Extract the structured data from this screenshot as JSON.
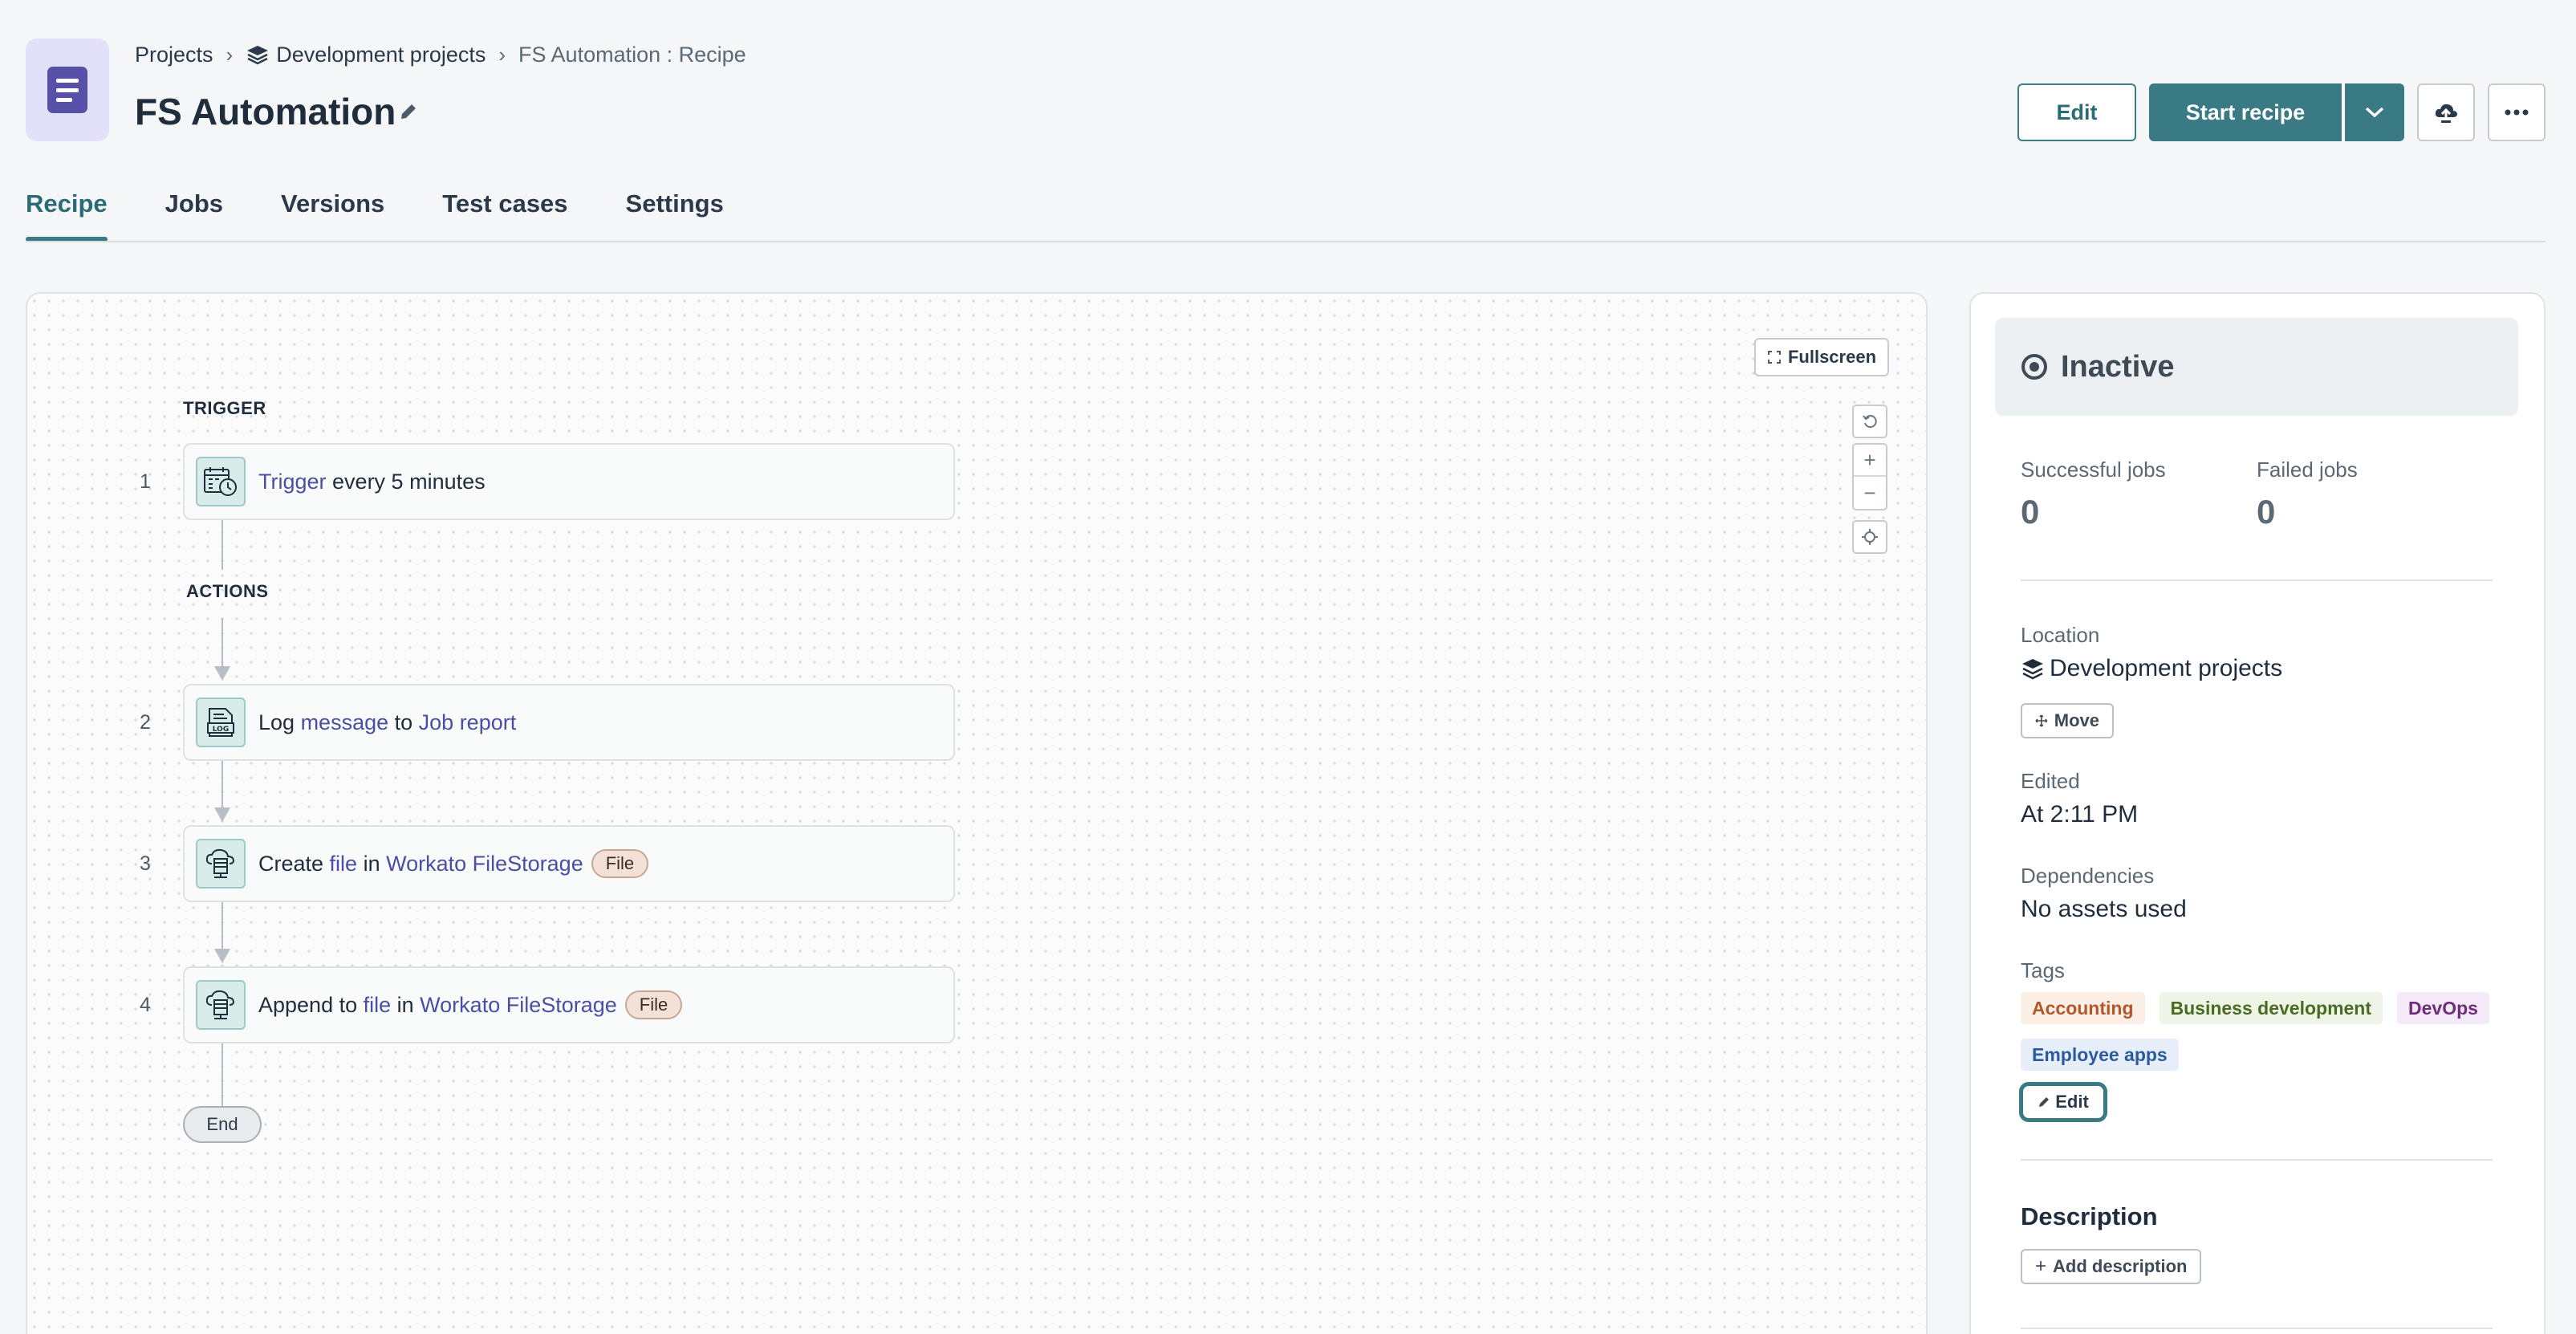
{
  "breadcrumb": {
    "projects": "Projects",
    "folder": "Development projects",
    "current": "FS Automation : Recipe"
  },
  "header": {
    "title": "FS Automation",
    "edit_label": "Edit",
    "start_label": "Start recipe"
  },
  "tabs": [
    {
      "label": "Recipe",
      "active": true
    },
    {
      "label": "Jobs"
    },
    {
      "label": "Versions"
    },
    {
      "label": "Test cases"
    },
    {
      "label": "Settings"
    }
  ],
  "canvas": {
    "fullscreen_label": "Fullscreen",
    "trigger_label": "TRIGGER",
    "actions_label": "ACTIONS",
    "end_label": "End",
    "steps": [
      {
        "num": "1",
        "parts": [
          "Trigger",
          " every 5 minutes"
        ]
      },
      {
        "num": "2",
        "parts": [
          "Log ",
          "message",
          " to ",
          "Job report"
        ]
      },
      {
        "num": "3",
        "parts": [
          "Create ",
          "file",
          " in ",
          "Workato FileStorage"
        ],
        "pill": "File"
      },
      {
        "num": "4",
        "parts": [
          "Append to ",
          "file",
          " in ",
          "Workato FileStorage"
        ],
        "pill": "File"
      }
    ]
  },
  "panel": {
    "status": "Inactive",
    "successful_label": "Successful jobs",
    "successful_value": "0",
    "failed_label": "Failed jobs",
    "failed_value": "0",
    "location_label": "Location",
    "location_value": "Development projects",
    "move_label": "Move",
    "edited_label": "Edited",
    "edited_value": "At 2:11 PM",
    "dependencies_label": "Dependencies",
    "dependencies_value": "No assets used",
    "tags_label": "Tags",
    "tags": [
      {
        "label": "Accounting",
        "bg": "#fbeee4",
        "fg": "#b4572a"
      },
      {
        "label": "Business development",
        "bg": "#eef4e6",
        "fg": "#4a6b24"
      },
      {
        "label": "DevOps",
        "bg": "#f4e9f6",
        "fg": "#6d2f7a"
      },
      {
        "label": "Employee apps",
        "bg": "#e6eef9",
        "fg": "#2c5b9c"
      }
    ],
    "tags_edit_label": "Edit",
    "description_title": "Description",
    "add_description_label": "Add description"
  }
}
